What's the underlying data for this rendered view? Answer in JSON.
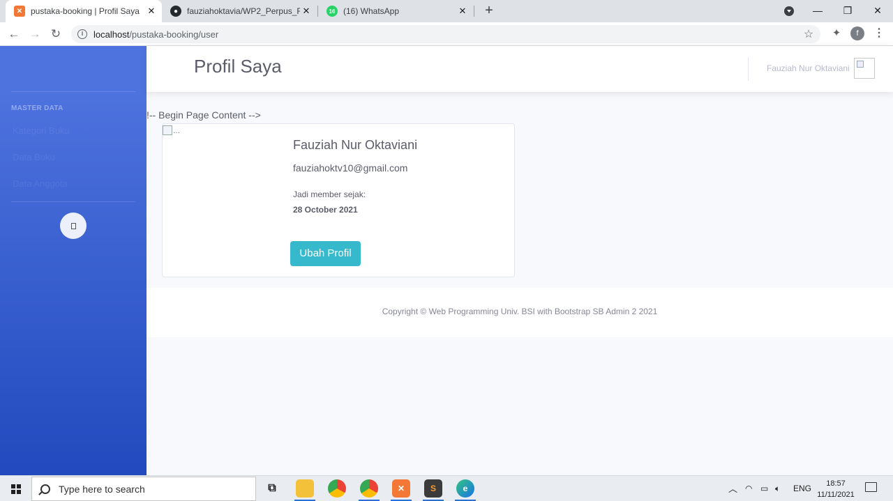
{
  "browser": {
    "tabs": [
      {
        "title": "pustaka-booking | Profil Saya",
        "active": true
      },
      {
        "title": "fauziahoktavia/WP2_Perpus_Fauz",
        "active": false
      },
      {
        "title": "(16) WhatsApp",
        "active": false
      }
    ],
    "whatsapp_badge": "16",
    "url_host": "localhost",
    "url_path": "/pustaka-booking/user",
    "profile_initial": "f"
  },
  "sidebar": {
    "heading": "MASTER DATA",
    "items": [
      {
        "label": "Kategori Buku"
      },
      {
        "label": "Data Buku"
      },
      {
        "label": "Data Anggota"
      }
    ]
  },
  "topbar": {
    "page_title": "Profil Saya",
    "user_name": "Fauziah Nur Oktaviani"
  },
  "content": {
    "comment_leak": "!-- Begin Page Content -->",
    "image_alt": "...",
    "profile": {
      "name": "Fauziah Nur Oktaviani",
      "email": "fauziahoktv10@gmail.com",
      "member_since_label": "Jadi member sejak:",
      "member_since_date": "28 October 2021"
    },
    "edit_button": "Ubah Profil"
  },
  "footer": {
    "copyright": "Copyright © Web Programming Univ. BSI with Bootstrap SB Admin 2 2021"
  },
  "taskbar": {
    "search_placeholder": "Type here to search",
    "language": "ENG",
    "time": "18:57",
    "date": "11/11/2021",
    "colors": {
      "accent": "#2a6fd6"
    }
  },
  "theme": {
    "sidebar_gradient_top": "#4e73df",
    "sidebar_gradient_bottom": "#224abe",
    "button_info": "#36b9cc",
    "text_gray": "#5a5c69"
  }
}
